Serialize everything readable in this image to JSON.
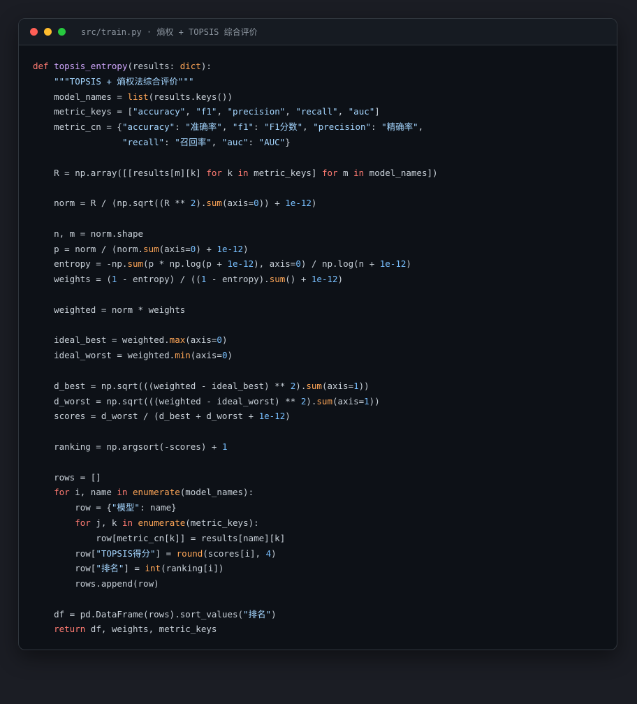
{
  "window": {
    "title": "src/train.py · 熵权 + TOPSIS 综合评价"
  },
  "colors": {
    "keyword": "#ff7b72",
    "function": "#d2a8ff",
    "builtin": "#ffa657",
    "string": "#a5d6ff",
    "number": "#79c0ff",
    "plain": "#c9d1d9"
  },
  "code_lines": [
    [
      [
        "kw",
        "def "
      ],
      [
        "fn",
        "topsis_entropy"
      ],
      [
        "pl",
        "(results: "
      ],
      [
        "bi",
        "dict"
      ],
      [
        "pl",
        "):"
      ]
    ],
    [
      [
        "pl",
        "    "
      ],
      [
        "str",
        "\"\"\"TOPSIS + 熵权法综合评价\"\"\""
      ]
    ],
    [
      [
        "pl",
        "    model_names = "
      ],
      [
        "bi",
        "list"
      ],
      [
        "pl",
        "(results.keys())"
      ]
    ],
    [
      [
        "pl",
        "    metric_keys = ["
      ],
      [
        "str",
        "\"accuracy\""
      ],
      [
        "pl",
        ", "
      ],
      [
        "str",
        "\"f1\""
      ],
      [
        "pl",
        ", "
      ],
      [
        "str",
        "\"precision\""
      ],
      [
        "pl",
        ", "
      ],
      [
        "str",
        "\"recall\""
      ],
      [
        "pl",
        ", "
      ],
      [
        "str",
        "\"auc\""
      ],
      [
        "pl",
        "]"
      ]
    ],
    [
      [
        "pl",
        "    metric_cn = {"
      ],
      [
        "str",
        "\"accuracy\""
      ],
      [
        "pl",
        ": "
      ],
      [
        "str",
        "\"准确率\""
      ],
      [
        "pl",
        ", "
      ],
      [
        "str",
        "\"f1\""
      ],
      [
        "pl",
        ": "
      ],
      [
        "str",
        "\"F1分数\""
      ],
      [
        "pl",
        ", "
      ],
      [
        "str",
        "\"precision\""
      ],
      [
        "pl",
        ": "
      ],
      [
        "str",
        "\"精确率\""
      ],
      [
        "pl",
        ","
      ]
    ],
    [
      [
        "pl",
        "                 "
      ],
      [
        "str",
        "\"recall\""
      ],
      [
        "pl",
        ": "
      ],
      [
        "str",
        "\"召回率\""
      ],
      [
        "pl",
        ", "
      ],
      [
        "str",
        "\"auc\""
      ],
      [
        "pl",
        ": "
      ],
      [
        "str",
        "\"AUC\""
      ],
      [
        "pl",
        "}"
      ]
    ],
    [],
    [
      [
        "pl",
        "    R = np.array([[results[m][k] "
      ],
      [
        "kw",
        "for"
      ],
      [
        "pl",
        " k "
      ],
      [
        "kw",
        "in"
      ],
      [
        "pl",
        " metric_keys] "
      ],
      [
        "kw",
        "for"
      ],
      [
        "pl",
        " m "
      ],
      [
        "kw",
        "in"
      ],
      [
        "pl",
        " model_names])"
      ]
    ],
    [],
    [
      [
        "pl",
        "    norm = R / (np.sqrt((R ** "
      ],
      [
        "num",
        "2"
      ],
      [
        "pl",
        ")."
      ],
      [
        "bi",
        "sum"
      ],
      [
        "pl",
        "(axis="
      ],
      [
        "num",
        "0"
      ],
      [
        "pl",
        ")) + "
      ],
      [
        "num",
        "1e-12"
      ],
      [
        "pl",
        ")"
      ]
    ],
    [],
    [
      [
        "pl",
        "    n, m = norm.shape"
      ]
    ],
    [
      [
        "pl",
        "    p = norm / (norm."
      ],
      [
        "bi",
        "sum"
      ],
      [
        "pl",
        "(axis="
      ],
      [
        "num",
        "0"
      ],
      [
        "pl",
        ") + "
      ],
      [
        "num",
        "1e-12"
      ],
      [
        "pl",
        ")"
      ]
    ],
    [
      [
        "pl",
        "    entropy = -np."
      ],
      [
        "bi",
        "sum"
      ],
      [
        "pl",
        "(p * np.log(p + "
      ],
      [
        "num",
        "1e-12"
      ],
      [
        "pl",
        "), axis="
      ],
      [
        "num",
        "0"
      ],
      [
        "pl",
        ") / np.log(n + "
      ],
      [
        "num",
        "1e-12"
      ],
      [
        "pl",
        ")"
      ]
    ],
    [
      [
        "pl",
        "    weights = ("
      ],
      [
        "num",
        "1"
      ],
      [
        "pl",
        " - entropy) / (("
      ],
      [
        "num",
        "1"
      ],
      [
        "pl",
        " - entropy)."
      ],
      [
        "bi",
        "sum"
      ],
      [
        "pl",
        "() + "
      ],
      [
        "num",
        "1e-12"
      ],
      [
        "pl",
        ")"
      ]
    ],
    [],
    [
      [
        "pl",
        "    weighted = norm * weights"
      ]
    ],
    [],
    [
      [
        "pl",
        "    ideal_best = weighted."
      ],
      [
        "bi",
        "max"
      ],
      [
        "pl",
        "(axis="
      ],
      [
        "num",
        "0"
      ],
      [
        "pl",
        ")"
      ]
    ],
    [
      [
        "pl",
        "    ideal_worst = weighted."
      ],
      [
        "bi",
        "min"
      ],
      [
        "pl",
        "(axis="
      ],
      [
        "num",
        "0"
      ],
      [
        "pl",
        ")"
      ]
    ],
    [],
    [
      [
        "pl",
        "    d_best = np.sqrt(((weighted - ideal_best) ** "
      ],
      [
        "num",
        "2"
      ],
      [
        "pl",
        ")."
      ],
      [
        "bi",
        "sum"
      ],
      [
        "pl",
        "(axis="
      ],
      [
        "num",
        "1"
      ],
      [
        "pl",
        "))"
      ]
    ],
    [
      [
        "pl",
        "    d_worst = np.sqrt(((weighted - ideal_worst) ** "
      ],
      [
        "num",
        "2"
      ],
      [
        "pl",
        ")."
      ],
      [
        "bi",
        "sum"
      ],
      [
        "pl",
        "(axis="
      ],
      [
        "num",
        "1"
      ],
      [
        "pl",
        "))"
      ]
    ],
    [
      [
        "pl",
        "    scores = d_worst / (d_best + d_worst + "
      ],
      [
        "num",
        "1e-12"
      ],
      [
        "pl",
        ")"
      ]
    ],
    [],
    [
      [
        "pl",
        "    ranking = np.argsort(-scores) + "
      ],
      [
        "num",
        "1"
      ]
    ],
    [],
    [
      [
        "pl",
        "    rows = []"
      ]
    ],
    [
      [
        "pl",
        "    "
      ],
      [
        "kw",
        "for"
      ],
      [
        "pl",
        " i, name "
      ],
      [
        "kw",
        "in"
      ],
      [
        "pl",
        " "
      ],
      [
        "bi",
        "enumerate"
      ],
      [
        "pl",
        "(model_names):"
      ]
    ],
    [
      [
        "pl",
        "        row = {"
      ],
      [
        "str",
        "\"模型\""
      ],
      [
        "pl",
        ": name}"
      ]
    ],
    [
      [
        "pl",
        "        "
      ],
      [
        "kw",
        "for"
      ],
      [
        "pl",
        " j, k "
      ],
      [
        "kw",
        "in"
      ],
      [
        "pl",
        " "
      ],
      [
        "bi",
        "enumerate"
      ],
      [
        "pl",
        "(metric_keys):"
      ]
    ],
    [
      [
        "pl",
        "            row[metric_cn[k]] = results[name][k]"
      ]
    ],
    [
      [
        "pl",
        "        row["
      ],
      [
        "str",
        "\"TOPSIS得分\""
      ],
      [
        "pl",
        "] = "
      ],
      [
        "bi",
        "round"
      ],
      [
        "pl",
        "(scores[i], "
      ],
      [
        "num",
        "4"
      ],
      [
        "pl",
        ")"
      ]
    ],
    [
      [
        "pl",
        "        row["
      ],
      [
        "str",
        "\"排名\""
      ],
      [
        "pl",
        "] = "
      ],
      [
        "bi",
        "int"
      ],
      [
        "pl",
        "(ranking[i])"
      ]
    ],
    [
      [
        "pl",
        "        rows.append(row)"
      ]
    ],
    [],
    [
      [
        "pl",
        "    df = pd.DataFrame(rows).sort_values("
      ],
      [
        "str",
        "\"排名\""
      ],
      [
        "pl",
        ")"
      ]
    ],
    [
      [
        "pl",
        "    "
      ],
      [
        "kw",
        "return"
      ],
      [
        "pl",
        " df, weights, metric_keys"
      ]
    ]
  ]
}
